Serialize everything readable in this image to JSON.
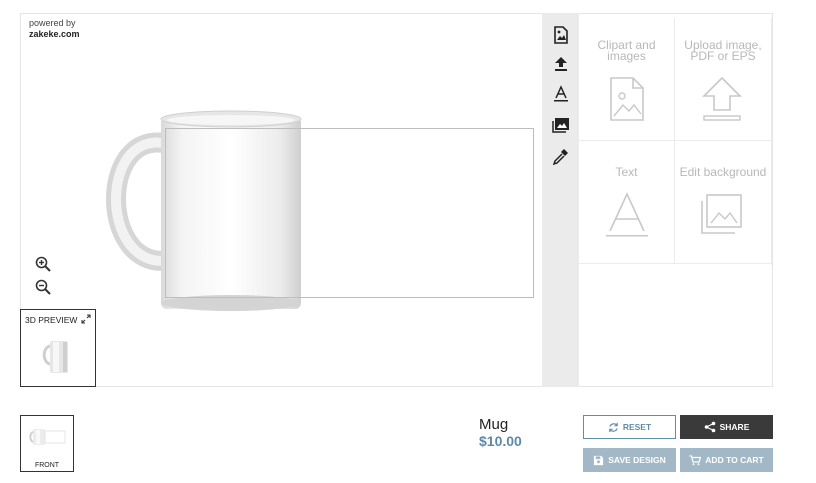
{
  "branding": {
    "line1": "powered by",
    "line2": "zakeke.com"
  },
  "toolbar": {
    "tools": [
      {
        "name": "image-icon"
      },
      {
        "name": "upload-icon"
      },
      {
        "name": "text-icon"
      },
      {
        "name": "background-icon"
      },
      {
        "name": "color-picker-icon"
      }
    ]
  },
  "panel": {
    "clipart_label": "Clipart and images",
    "upload_label": "Upload image, PDF or EPS",
    "text_label": "Text",
    "background_label": "Edit background"
  },
  "preview3d": {
    "title": "3D PREVIEW"
  },
  "sides": [
    {
      "label": "FRONT"
    }
  ],
  "product": {
    "name": "Mug",
    "price": "$10.00"
  },
  "buttons": {
    "reset": "RESET",
    "share": "SHARE",
    "save": "SAVE DESIGN",
    "cart": "ADD TO CART"
  },
  "colors": {
    "accent": "#5f8ea8",
    "price": "#5b8aa8",
    "dark": "#3a3a3a",
    "disabled": "#a3b8c7"
  }
}
